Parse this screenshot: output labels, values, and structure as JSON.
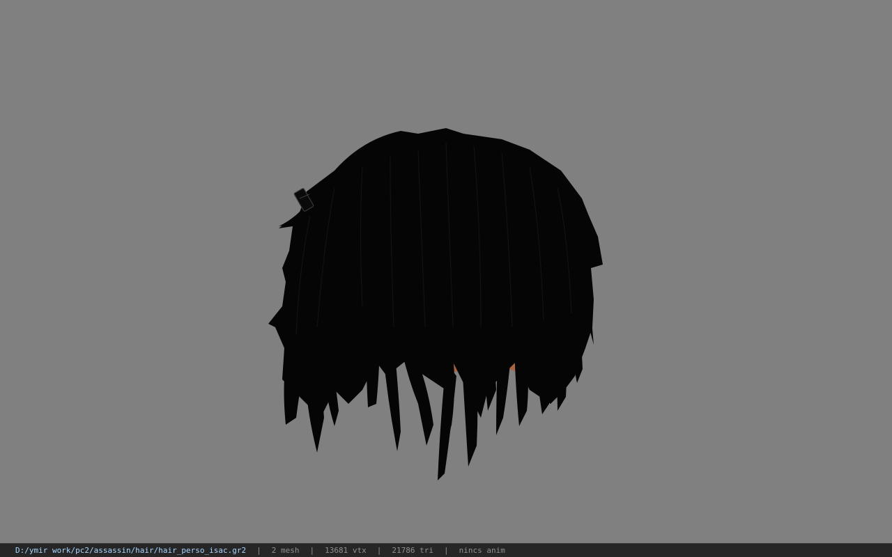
{
  "viewport": {
    "background": "#808080",
    "model": {
      "skin_color": "#a8643f",
      "hair_color": "#050505"
    }
  },
  "statusbar": {
    "file_path": "D:/ymir work/pc2/assassin/hair/hair_perso_isac.gr2",
    "separator": "|",
    "mesh": "2 mesh",
    "vertices": "13681 vtx",
    "triangles": "21786 tri",
    "animation": "nincs anim",
    "path_color": "#a9d6ff",
    "text_color": "#8f8f8f"
  }
}
